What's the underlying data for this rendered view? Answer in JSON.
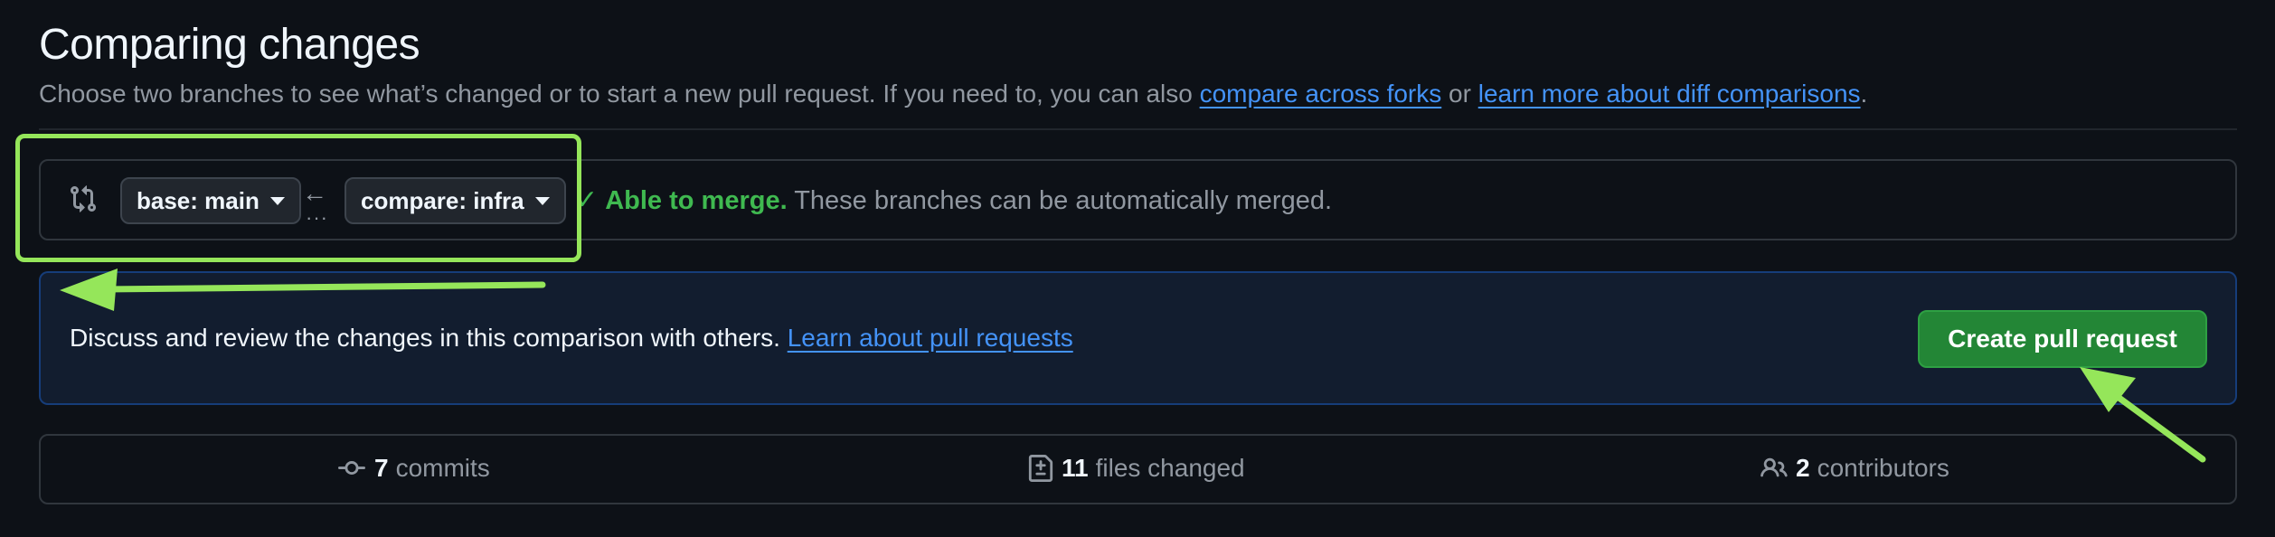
{
  "header": {
    "title": "Comparing changes",
    "subtitle_prefix": "Choose two branches to see what’s changed or to start a new pull request. If you need to, you can also",
    "link_forks": "compare across forks",
    "subtitle_or": "or",
    "link_diff": "learn more about diff comparisons",
    "subtitle_end": "."
  },
  "compare": {
    "base_label": "base: main",
    "compare_label": "compare: infra",
    "merge_ok": "Able to merge.",
    "merge_desc": "These branches can be automatically merged."
  },
  "discuss": {
    "text": "Discuss and review the changes in this comparison with others.",
    "link": "Learn about pull requests",
    "button": "Create pull request"
  },
  "stats": {
    "commits_count": "7",
    "commits_label": "commits",
    "files_count": "11",
    "files_label": "files changed",
    "contributors_count": "2",
    "contributors_label": "contributors"
  },
  "colors": {
    "annotation": "#95e65a",
    "success": "#3fb950",
    "link": "#4493f8",
    "button": "#238636"
  },
  "icons": [
    "git-compare-icon",
    "arrow-left-icon",
    "check-icon",
    "commit-icon",
    "file-diff-icon",
    "people-icon"
  ]
}
